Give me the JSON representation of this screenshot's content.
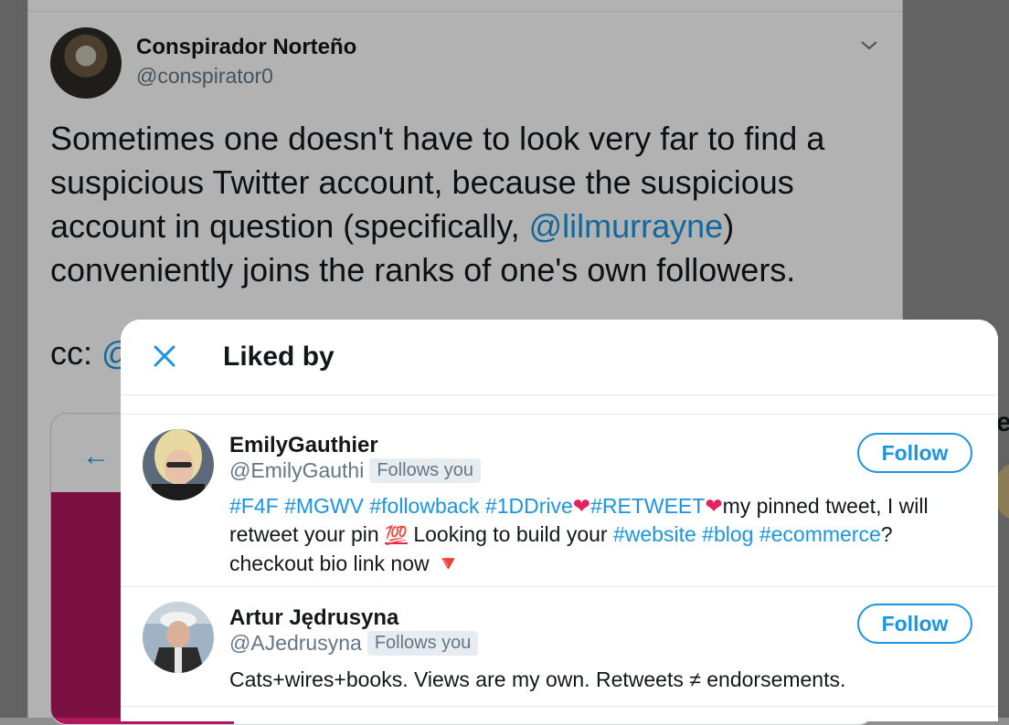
{
  "background_tweet": {
    "author_name": "Conspirador Norteño",
    "author_handle": "@conspirator0",
    "text_part1": "Sometimes one doesn't have to look very far to find a suspicious Twitter account, because the suspicious account in question (specifically, ",
    "mention": "@lilmurrayne",
    "text_part2": ") conveniently joins the ranks of one's own followers.",
    "cc_label": "cc: ",
    "cc_mention": "@"
  },
  "modal": {
    "title": "Liked by",
    "users": [
      {
        "name": "EmilyGauthier",
        "handle": "@EmilyGauthi",
        "follows_you": "Follows you",
        "follow_label": "Follow",
        "bio": {
          "tags1": "#F4F #MGWV #followback #1DDrive",
          "heart": "❤",
          "tag2": "#RETWEET",
          "text1": "my pinned tweet, I will retweet your pin ",
          "emoji100": "💯",
          "text2": " Looking to build your ",
          "tags3": "#website #blog #ecommerce",
          "text3": "? checkout bio link now ",
          "triangle": "🔻"
        }
      },
      {
        "name": "Artur Jędrusyna",
        "handle": "@AJedrusyna",
        "follows_you": "Follows you",
        "follow_label": "Follow",
        "bio_text": "Cats+wires+books. Views are my own. Retweets ≠ endorsements."
      }
    ]
  },
  "colors": {
    "accent": "#1b95e0",
    "text": "#14171a",
    "muted": "#657786",
    "heart": "#e0245e"
  }
}
